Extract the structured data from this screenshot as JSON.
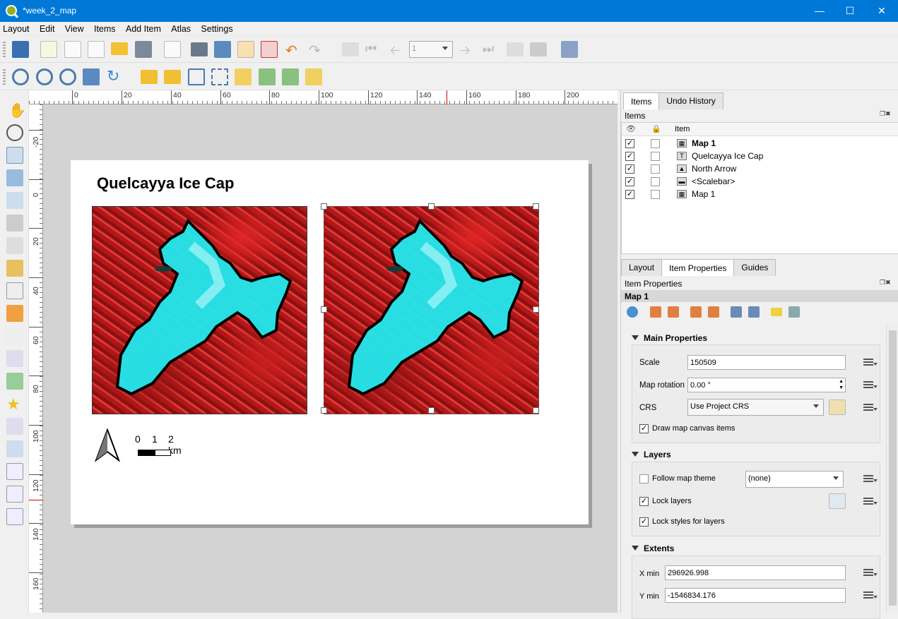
{
  "window": {
    "title": "*week_2_map"
  },
  "menu": [
    "Layout",
    "Edit",
    "View",
    "Items",
    "Add Item",
    "Atlas",
    "Settings"
  ],
  "toolbar": {
    "atlas_page": "1"
  },
  "ruler": {
    "h_ticks": [
      "0",
      "20",
      "40",
      "60",
      "80",
      "100",
      "120",
      "140",
      "160",
      "180",
      "200"
    ],
    "v_ticks": [
      "-20",
      "0",
      "20",
      "40",
      "60",
      "80",
      "100",
      "120",
      "140",
      "160"
    ]
  },
  "layout": {
    "map_title": "Quelcayya Ice Cap",
    "scalebar": {
      "label0": "0",
      "label1": "1",
      "label2": "2 km"
    }
  },
  "items_panel": {
    "tabs": [
      "Items",
      "Undo History"
    ],
    "title": "Items",
    "col_item": "Item",
    "rows": [
      {
        "name": "Map 1",
        "bold": true,
        "icon": "map-icon",
        "visible": true,
        "locked": false
      },
      {
        "name": "Quelcayya Ice Cap",
        "bold": false,
        "icon": "label-icon",
        "visible": true,
        "locked": false
      },
      {
        "name": "North Arrow",
        "bold": false,
        "icon": "picture-icon",
        "visible": true,
        "locked": false
      },
      {
        "name": "<Scalebar>",
        "bold": false,
        "icon": "scalebar-icon",
        "visible": true,
        "locked": false
      },
      {
        "name": "Map 1",
        "bold": false,
        "icon": "map-icon",
        "visible": true,
        "locked": false
      }
    ]
  },
  "props_panel": {
    "tabs": [
      "Layout",
      "Item Properties",
      "Guides"
    ],
    "title": "Item Properties",
    "item_name": "Map 1",
    "main": {
      "header": "Main Properties",
      "scale_label": "Scale",
      "scale": "150509",
      "rotation_label": "Map rotation",
      "rotation": "0.00 °",
      "crs_label": "CRS",
      "crs": "Use Project CRS",
      "draw_items_label": "Draw map canvas items",
      "draw_items": true
    },
    "layers": {
      "header": "Layers",
      "follow_theme_label": "Follow map theme",
      "follow_theme": false,
      "theme": "(none)",
      "lock_layers_label": "Lock layers",
      "lock_layers": true,
      "lock_styles_label": "Lock styles for layers",
      "lock_styles": true
    },
    "extents": {
      "header": "Extents",
      "xmin_label": "X min",
      "xmin": "296926.998",
      "ymin_label": "Y min",
      "ymin": "-1546834.176"
    }
  },
  "colors": {
    "accent": "#0078d7",
    "ice": "#22e8ee",
    "terrain": "#c02020"
  }
}
